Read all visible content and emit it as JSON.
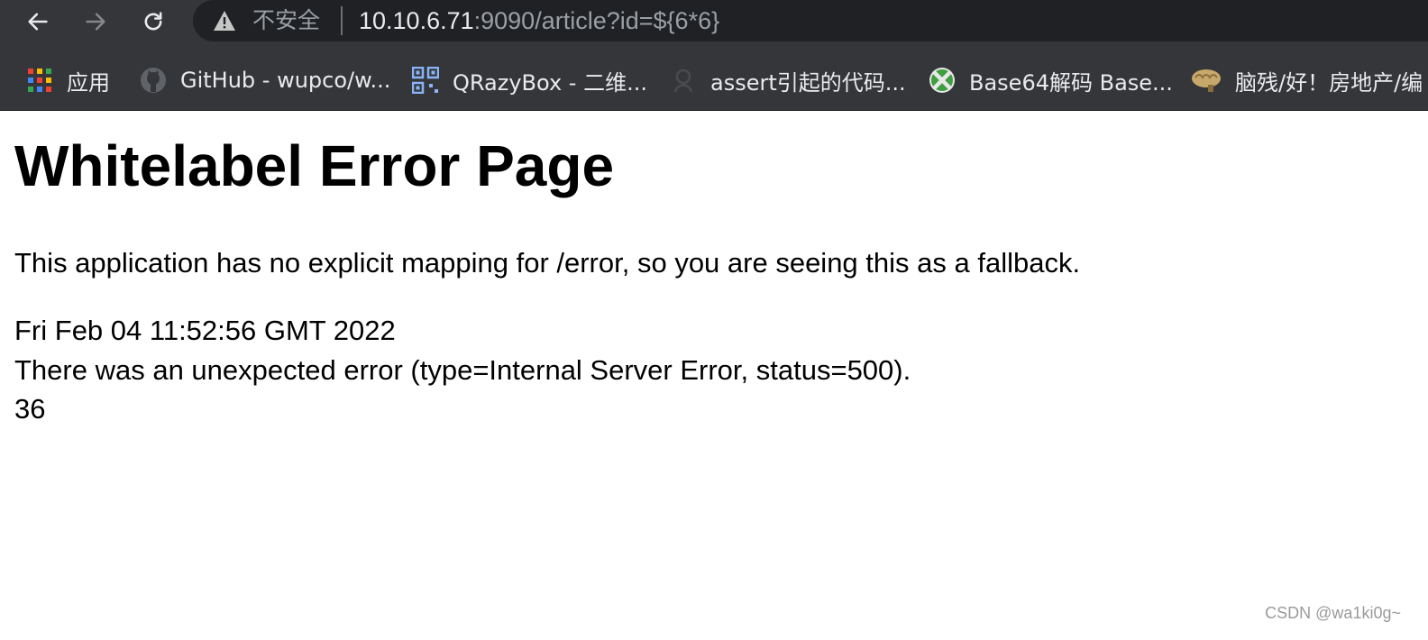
{
  "browser": {
    "insecure_label": "不安全",
    "url_host": "10.10.6.71",
    "url_rest": ":9090/article?id=${6*6}"
  },
  "bookmarks": [
    {
      "label": "应用",
      "icon": "apps-grid-icon"
    },
    {
      "label": "GitHub - wupco/w...",
      "icon": "github-icon"
    },
    {
      "label": "QRazyBox - 二维...",
      "icon": "qr-code-icon"
    },
    {
      "label": "assert引起的代码...",
      "icon": "bookmark-favicon"
    },
    {
      "label": "Base64解码 Base...",
      "icon": "xbox-icon"
    },
    {
      "label": "脑残/好！房地产/编",
      "icon": "brain-icon"
    }
  ],
  "page": {
    "title": "Whitelabel Error Page",
    "message": "This application has no explicit mapping for /error, so you are seeing this as a fallback.",
    "timestamp": "Fri Feb 04 11:52:56 GMT 2022",
    "error_line": "There was an unexpected error (type=Internal Server Error, status=500).",
    "result": "36"
  },
  "watermark": "CSDN @wa1ki0g~",
  "colors": {
    "chrome_bg": "#35363a",
    "omnibox_bg": "#202124",
    "text_light": "#e8eaed",
    "text_dim": "#9aa0a6"
  }
}
